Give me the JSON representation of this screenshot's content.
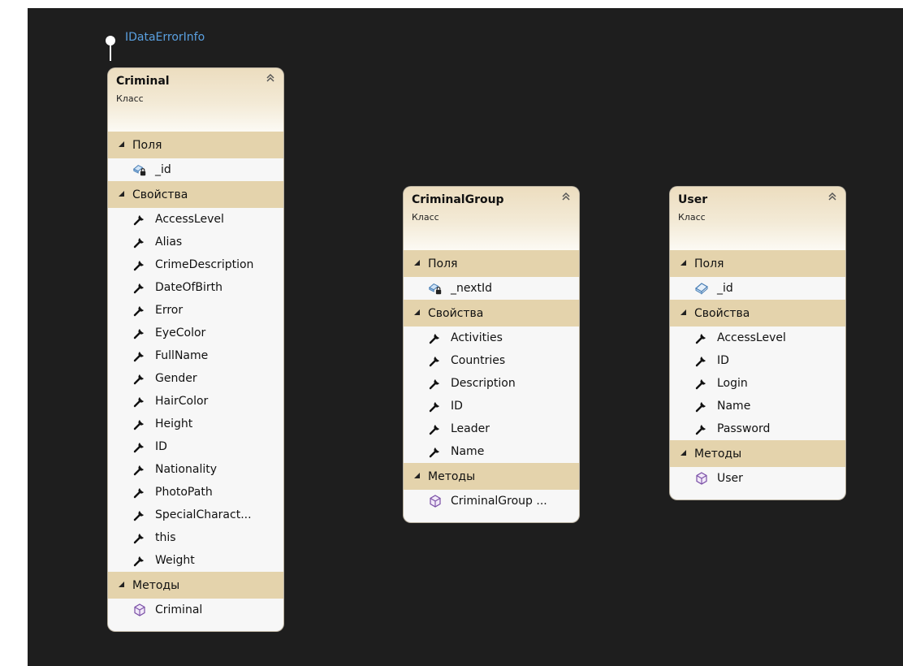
{
  "interface": {
    "label": "IDataErrorInfo"
  },
  "classes": [
    {
      "name": "Criminal",
      "kind": "Класс",
      "sections": [
        {
          "title": "Поля",
          "members": [
            {
              "label": "_id",
              "icon": "private-field-icon"
            }
          ]
        },
        {
          "title": "Свойства",
          "members": [
            {
              "label": "AccessLevel",
              "icon": "property-wrench-icon"
            },
            {
              "label": "Alias",
              "icon": "property-wrench-icon"
            },
            {
              "label": "CrimeDescription",
              "icon": "property-wrench-icon"
            },
            {
              "label": "DateOfBirth",
              "icon": "property-wrench-icon"
            },
            {
              "label": "Error",
              "icon": "property-wrench-icon"
            },
            {
              "label": "EyeColor",
              "icon": "property-wrench-icon"
            },
            {
              "label": "FullName",
              "icon": "property-wrench-icon"
            },
            {
              "label": "Gender",
              "icon": "property-wrench-icon"
            },
            {
              "label": "HairColor",
              "icon": "property-wrench-icon"
            },
            {
              "label": "Height",
              "icon": "property-wrench-icon"
            },
            {
              "label": "ID",
              "icon": "property-wrench-icon"
            },
            {
              "label": "Nationality",
              "icon": "property-wrench-icon"
            },
            {
              "label": "PhotoPath",
              "icon": "property-wrench-icon"
            },
            {
              "label": "SpecialCharact...",
              "icon": "property-wrench-icon"
            },
            {
              "label": "this",
              "icon": "property-wrench-icon"
            },
            {
              "label": "Weight",
              "icon": "property-wrench-icon"
            }
          ]
        },
        {
          "title": "Методы",
          "members": [
            {
              "label": "Criminal",
              "icon": "method-cube-icon"
            }
          ]
        }
      ]
    },
    {
      "name": "CriminalGroup",
      "kind": "Класс",
      "sections": [
        {
          "title": "Поля",
          "members": [
            {
              "label": "_nextId",
              "icon": "private-field-icon"
            }
          ]
        },
        {
          "title": "Свойства",
          "members": [
            {
              "label": "Activities",
              "icon": "property-wrench-icon"
            },
            {
              "label": "Countries",
              "icon": "property-wrench-icon"
            },
            {
              "label": "Description",
              "icon": "property-wrench-icon"
            },
            {
              "label": "ID",
              "icon": "property-wrench-icon"
            },
            {
              "label": "Leader",
              "icon": "property-wrench-icon"
            },
            {
              "label": "Name",
              "icon": "property-wrench-icon"
            }
          ]
        },
        {
          "title": "Методы",
          "members": [
            {
              "label": "CriminalGroup ...",
              "icon": "method-cube-icon"
            }
          ]
        }
      ]
    },
    {
      "name": "User",
      "kind": "Класс",
      "sections": [
        {
          "title": "Поля",
          "members": [
            {
              "label": "_id",
              "icon": "field-icon"
            }
          ]
        },
        {
          "title": "Свойства",
          "members": [
            {
              "label": "AccessLevel",
              "icon": "property-wrench-icon"
            },
            {
              "label": "ID",
              "icon": "property-wrench-icon"
            },
            {
              "label": "Login",
              "icon": "property-wrench-icon"
            },
            {
              "label": "Name",
              "icon": "property-wrench-icon"
            },
            {
              "label": "Password",
              "icon": "property-wrench-icon"
            }
          ]
        },
        {
          "title": "Методы",
          "members": [
            {
              "label": "User",
              "icon": "method-cube-icon"
            }
          ]
        }
      ]
    }
  ]
}
